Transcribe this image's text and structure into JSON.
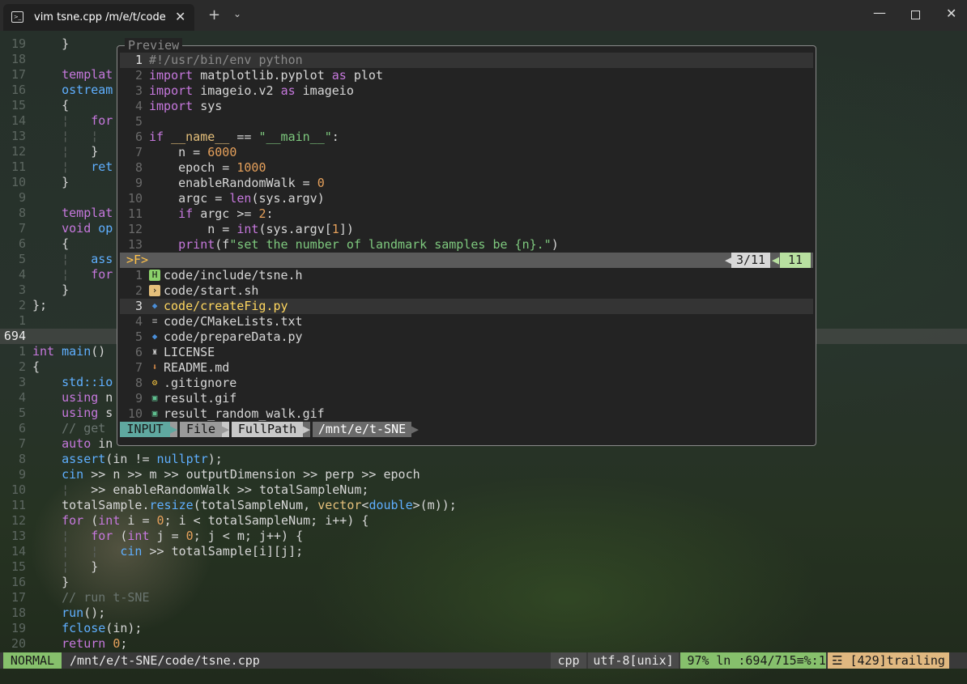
{
  "window": {
    "tab_title": "vim tsne.cpp  /m/e/t/code",
    "tab_icon": "terminal-icon"
  },
  "editor": {
    "lines": [
      {
        "n": "19",
        "t": "    }"
      },
      {
        "n": "18",
        "t": ""
      },
      {
        "n": "17",
        "t": "    templat"
      },
      {
        "n": "16",
        "t": "    ostream"
      },
      {
        "n": "15",
        "t": "    {"
      },
      {
        "n": "14",
        "t": "    ¦   for"
      },
      {
        "n": "13",
        "t": "    ¦   ¦"
      },
      {
        "n": "12",
        "t": "    ¦   }"
      },
      {
        "n": "11",
        "t": "    ¦   ret"
      },
      {
        "n": "10",
        "t": "    }"
      },
      {
        "n": "9",
        "t": ""
      },
      {
        "n": "8",
        "t": "    templat"
      },
      {
        "n": "7",
        "t": "    void op"
      },
      {
        "n": "6",
        "t": "    {"
      },
      {
        "n": "5",
        "t": "    ¦   ass"
      },
      {
        "n": "4",
        "t": "    ¦   for"
      },
      {
        "n": "3",
        "t": "    }"
      },
      {
        "n": "2",
        "t": "};"
      },
      {
        "n": "1",
        "t": ""
      },
      {
        "n": "694",
        "t": ""
      },
      {
        "n": "1",
        "t": "int main()"
      },
      {
        "n": "2",
        "t": "{"
      },
      {
        "n": "3",
        "t": "    std::io"
      },
      {
        "n": "4",
        "t": "    using n"
      },
      {
        "n": "5",
        "t": "    using s"
      },
      {
        "n": "6",
        "t": "    // get"
      },
      {
        "n": "7",
        "t": "    auto in"
      },
      {
        "n": "8",
        "t": "    assert(in != nullptr);"
      },
      {
        "n": "9",
        "t": "    cin >> n >> m >> outputDimension >> perp >> epoch"
      },
      {
        "n": "10",
        "t": "    ¦   >> enableRandomWalk >> totalSampleNum;"
      },
      {
        "n": "11",
        "t": "    totalSample.resize(totalSampleNum, vector<double>(m));"
      },
      {
        "n": "12",
        "t": "    for (int i = 0; i < totalSampleNum; i++) {"
      },
      {
        "n": "13",
        "t": "    ¦   for (int j = 0; j < m; j++) {"
      },
      {
        "n": "14",
        "t": "    ¦   ¦   cin >> totalSample[i][j];"
      },
      {
        "n": "15",
        "t": "    ¦   }"
      },
      {
        "n": "16",
        "t": "    }"
      },
      {
        "n": "17",
        "t": "    // run t-SNE"
      },
      {
        "n": "18",
        "t": "    run();"
      },
      {
        "n": "19",
        "t": "    fclose(in);"
      },
      {
        "n": "20",
        "t": "    return 0;"
      }
    ]
  },
  "preview": {
    "label": "Preview",
    "lines": [
      {
        "n": "1",
        "t": "#!/usr/bin/env python"
      },
      {
        "n": "2",
        "t": "import matplotlib.pyplot as plot"
      },
      {
        "n": "3",
        "t": "import imageio.v2 as imageio"
      },
      {
        "n": "4",
        "t": "import sys"
      },
      {
        "n": "5",
        "t": ""
      },
      {
        "n": "6",
        "t": "if __name__ == \"__main__\":"
      },
      {
        "n": "7",
        "t": "    n = 6000"
      },
      {
        "n": "8",
        "t": "    epoch = 1000"
      },
      {
        "n": "9",
        "t": "    enableRandomWalk = 0"
      },
      {
        "n": "10",
        "t": "    argc = len(sys.argv)"
      },
      {
        "n": "11",
        "t": "    if argc >= 2:"
      },
      {
        "n": "12",
        "t": "        n = int(sys.argv[1])"
      },
      {
        "n": "13",
        "t": "    print(f\"set the number of landmark samples be {n}.\")"
      }
    ]
  },
  "finder": {
    "prompt": ">F>",
    "match_count": "3/11",
    "total": "11",
    "files": [
      {
        "n": "1",
        "name": "code/include/tsne.h",
        "icon": "h-file-icon",
        "color": "#8bd06a"
      },
      {
        "n": "2",
        "name": "code/start.sh",
        "icon": "shell-file-icon",
        "color": "#e5c07b"
      },
      {
        "n": "3",
        "name": "code/createFig.py",
        "icon": "python-file-icon",
        "color": "#4a8ed8"
      },
      {
        "n": "4",
        "name": "code/CMakeLists.txt",
        "icon": "text-file-icon",
        "color": "#a0a0a0"
      },
      {
        "n": "5",
        "name": "code/prepareData.py",
        "icon": "python-file-icon",
        "color": "#4a8ed8"
      },
      {
        "n": "6",
        "name": "LICENSE",
        "icon": "license-icon",
        "color": "#c8c8c8"
      },
      {
        "n": "7",
        "name": "README.md",
        "icon": "markdown-icon",
        "color": "#d98c4a"
      },
      {
        "n": "8",
        "name": ".gitignore",
        "icon": "gear-icon",
        "color": "#f0c040"
      },
      {
        "n": "9",
        "name": "result.gif",
        "icon": "image-file-icon",
        "color": "#5fbf8f"
      },
      {
        "n": "10",
        "name": "result_random_walk.gif",
        "icon": "image-file-icon",
        "color": "#5fbf8f"
      }
    ],
    "selected_index": 2,
    "mode": "INPUT",
    "provider": "File",
    "match_type": "FullPath",
    "cwd": "/mnt/e/t-SNE"
  },
  "statusline": {
    "mode": "NORMAL",
    "path": "/mnt/e/t-SNE/code/tsne.cpp",
    "filetype": "cpp",
    "encoding": "utf-8[unix]",
    "percent": "97%",
    "position": "ln :694/715≡%:1",
    "trailing": "☲ [429]trailing"
  }
}
